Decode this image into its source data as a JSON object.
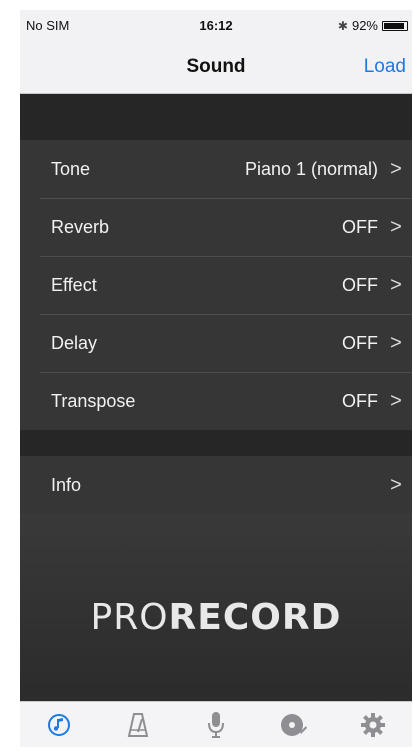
{
  "status": {
    "carrier": "No SIM",
    "time": "16:12",
    "battery": "92%",
    "battery_level": 0.92,
    "bluetooth_icon": "bluetooth-icon"
  },
  "nav": {
    "title": "Sound",
    "load": "Load"
  },
  "settings": [
    {
      "label": "Tone",
      "value": "Piano 1 (normal)"
    },
    {
      "label": "Reverb",
      "value": "OFF"
    },
    {
      "label": "Effect",
      "value": "OFF"
    },
    {
      "label": "Delay",
      "value": "OFF"
    },
    {
      "label": "Transpose",
      "value": "OFF"
    }
  ],
  "info": {
    "label": "Info"
  },
  "chevron": ">",
  "logo": {
    "pro": "PRO",
    "record": "RECORD"
  },
  "tabs": [
    {
      "icon": "music-note-icon",
      "active": true
    },
    {
      "icon": "metronome-icon",
      "active": false
    },
    {
      "icon": "microphone-icon",
      "active": false
    },
    {
      "icon": "record-disc-icon",
      "active": false
    },
    {
      "icon": "gear-icon",
      "active": false
    }
  ],
  "colors": {
    "accent": "#1a7be3",
    "inactive_icon": "#8e8e93"
  }
}
